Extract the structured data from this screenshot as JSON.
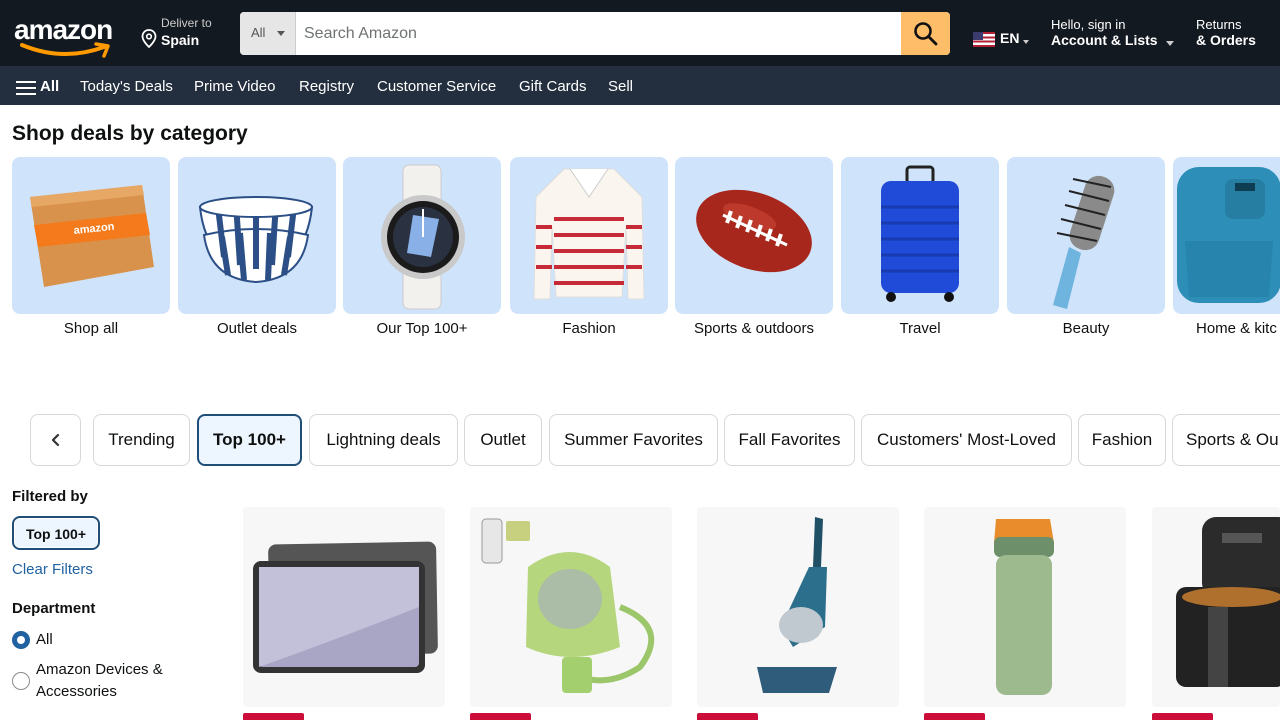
{
  "header": {
    "logo_text": "amazon",
    "deliver_line1": "Deliver to",
    "deliver_line2": "Spain",
    "search_category": "All",
    "search_placeholder": "Search Amazon",
    "language": "EN",
    "account_line1": "Hello, sign in",
    "account_line2": "Account & Lists",
    "orders_line1": "Returns",
    "orders_line2": "& Orders"
  },
  "subnav": {
    "all_label": "All",
    "links": [
      "Today's Deals",
      "Prime Video",
      "Registry",
      "Customer Service",
      "Gift Cards",
      "Sell"
    ]
  },
  "categories": {
    "title": "Shop deals by category",
    "items": [
      {
        "label": "Shop all",
        "icon": "amazon-box-image"
      },
      {
        "label": "Outlet deals",
        "icon": "striped-bowls-image"
      },
      {
        "label": "Our Top 100+",
        "icon": "smartwatch-image"
      },
      {
        "label": "Fashion",
        "icon": "striped-sweater-image"
      },
      {
        "label": "Sports & outdoors",
        "icon": "football-image"
      },
      {
        "label": "Travel",
        "icon": "suitcase-image"
      },
      {
        "label": "Beauty",
        "icon": "hair-brush-dryer-image"
      },
      {
        "label": "Home & kitc",
        "icon": "air-fryer-image"
      }
    ],
    "box_print": "amazon"
  },
  "pills": {
    "items": [
      "Trending",
      "Top 100+",
      "Lightning deals",
      "Outlet",
      "Summer Favorites",
      "Fall Favorites",
      "Customers' Most-Loved",
      "Fashion",
      "Sports & Ou"
    ],
    "active_index": 1
  },
  "filters": {
    "title": "Filtered by",
    "chip": "Top 100+",
    "clear": "Clear Filters",
    "department_title": "Department",
    "options": [
      {
        "label": "All",
        "selected": true
      },
      {
        "label": "Amazon Devices & Accessories",
        "selected": false
      }
    ]
  },
  "products": [
    {
      "icon": "tablet-image"
    },
    {
      "icon": "carpet-cleaner-image"
    },
    {
      "icon": "upright-vacuum-image"
    },
    {
      "icon": "water-bottle-image"
    },
    {
      "icon": "air-fryer-image"
    }
  ],
  "colors": {
    "nav_dark": "#131921",
    "nav_sub": "#232f3e",
    "search_button": "#febd69",
    "tile_bg": "#cfe4fb",
    "link": "#2162a1",
    "deal_badge": "#cc0c39"
  }
}
